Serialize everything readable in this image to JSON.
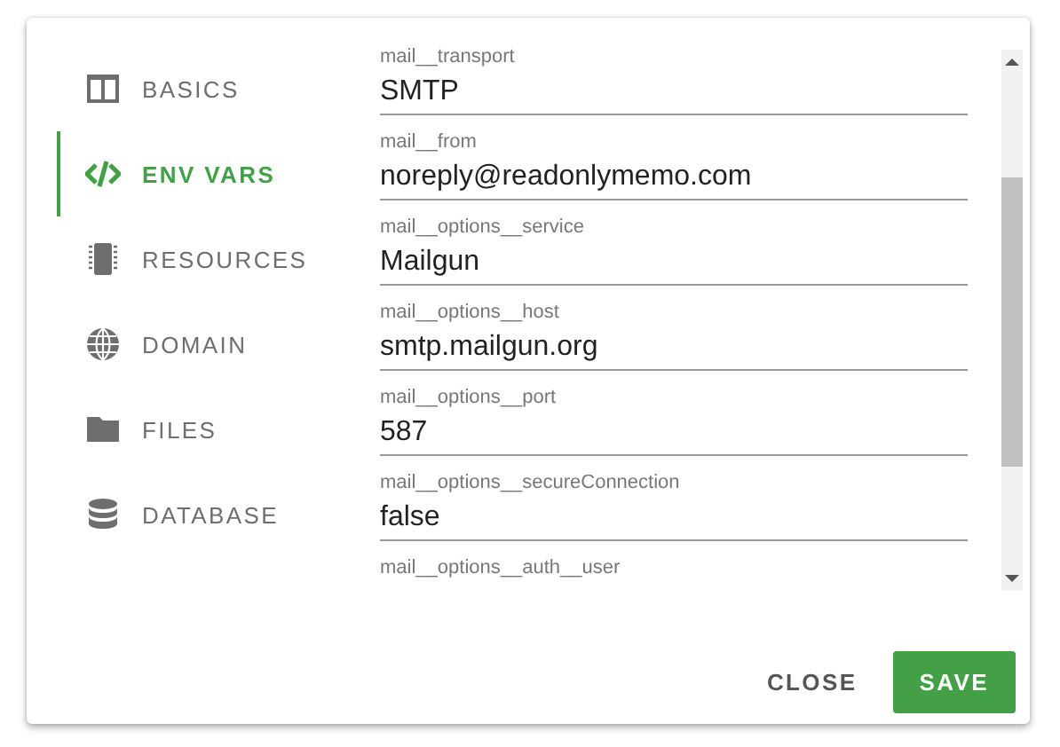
{
  "sidebar": {
    "items": [
      {
        "label": "BASICS",
        "kind": "columns",
        "selected": false
      },
      {
        "label": "ENV VARS",
        "kind": "code",
        "selected": true
      },
      {
        "label": "RESOURCES",
        "kind": "chip",
        "selected": false
      },
      {
        "label": "DOMAIN",
        "kind": "globe",
        "selected": false
      },
      {
        "label": "FILES",
        "kind": "folder",
        "selected": false
      },
      {
        "label": "DATABASE",
        "kind": "database",
        "selected": false
      }
    ]
  },
  "fields": [
    {
      "label": "mail__transport",
      "value": "SMTP"
    },
    {
      "label": "mail__from",
      "value": "noreply@readonlymemo.com"
    },
    {
      "label": "mail__options__service",
      "value": "Mailgun"
    },
    {
      "label": "mail__options__host",
      "value": "smtp.mailgun.org"
    },
    {
      "label": "mail__options__port",
      "value": "587"
    },
    {
      "label": "mail__options__secureConnection",
      "value": "false"
    },
    {
      "label": "mail__options__auth__user"
    }
  ],
  "buttons": [
    {
      "label": "CLOSE",
      "kind": "text"
    },
    {
      "label": "SAVE",
      "kind": "primary"
    }
  ]
}
